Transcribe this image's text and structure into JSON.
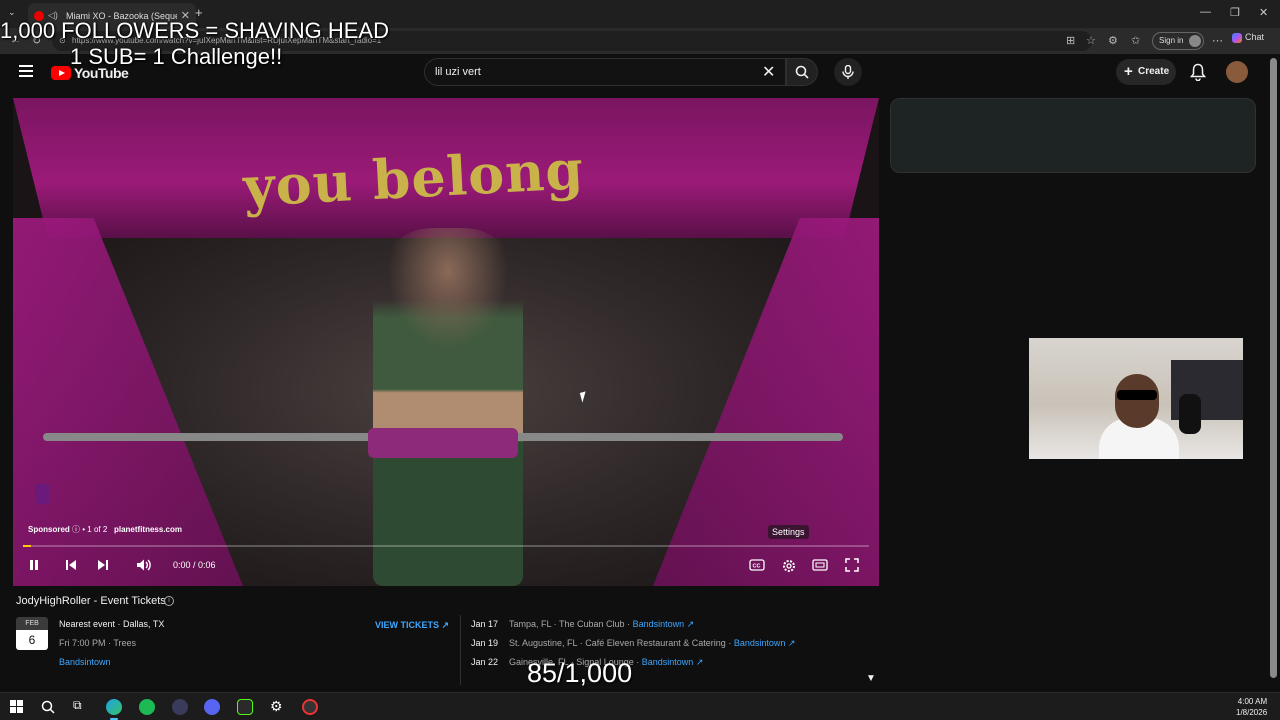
{
  "browser": {
    "tab_title": "Miami XO - Bazooka (Sequel)",
    "url": "https://www.youtube.com/watch?v=juIXepMarITM&list=RDjuIXepMarITM&start_radio=1",
    "signin_label": "Sign in",
    "chat_label": "Chat"
  },
  "youtube": {
    "logo_text": "YouTube",
    "search_value": "lil uzi vert",
    "create_label": "Create"
  },
  "overlays": {
    "line1": "1,000 FOLLOWERS = SHAVING HEAD",
    "line2": "1 SUB= 1 Challenge!!",
    "counter": "85/1,000"
  },
  "player": {
    "video_sign_text": "you belong",
    "sponsored": "Sponsored",
    "ad_position": "• 1 of 2",
    "ad_domain": "planetfitness.com",
    "settings_tooltip": "Settings",
    "time": "0:00 / 0:06",
    "progress_fraction": 0.01
  },
  "events": {
    "title": "JodyHighRoller - Event Tickets",
    "featured": {
      "month": "FEB",
      "day": "6",
      "headline": "Nearest event · Dallas, TX",
      "detail": "Fri 7:00 PM · Trees",
      "provider": "Bandsintown"
    },
    "view_tickets": "VIEW TICKETS",
    "list": [
      {
        "date": "Jan 17",
        "place": "Tampa, FL · The Cuban Club",
        "provider": "Bandsintown"
      },
      {
        "date": "Jan 19",
        "place": "St. Augustine, FL · Café Eleven Restaurant & Catering",
        "provider": "Bandsintown"
      },
      {
        "date": "Jan 22",
        "place": "Gainesville, FL · Signal Lounge",
        "provider": "Bandsintown"
      }
    ]
  },
  "taskbar": {
    "time": "4:00 AM",
    "date": "1/8/2026"
  },
  "colors": {
    "accent_link": "#3ea6ff",
    "youtube_red": "#ff0000",
    "progress_yellow": "#ffcc00"
  }
}
